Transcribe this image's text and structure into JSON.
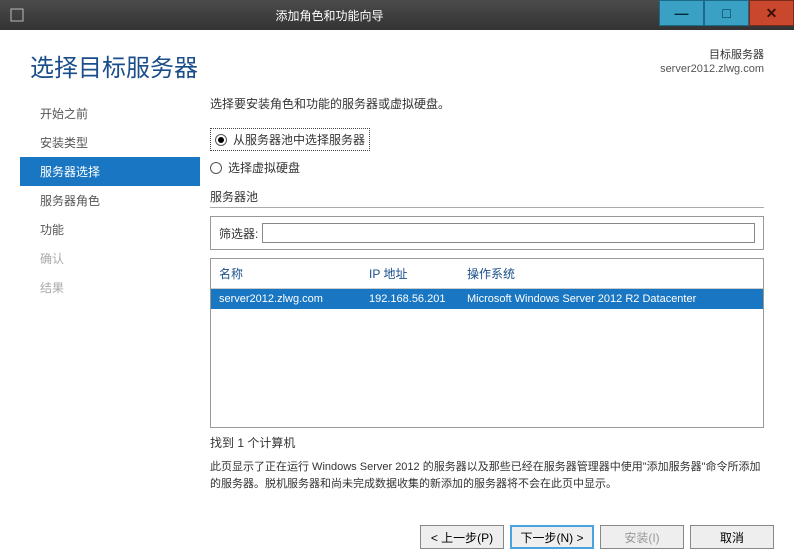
{
  "window": {
    "title": "添加角色和功能向导"
  },
  "header": {
    "page_title": "选择目标服务器",
    "target_label": "目标服务器",
    "target_server": "server2012.zlwg.com"
  },
  "nav": {
    "items": [
      {
        "label": "开始之前",
        "state": "normal"
      },
      {
        "label": "安装类型",
        "state": "normal"
      },
      {
        "label": "服务器选择",
        "state": "selected"
      },
      {
        "label": "服务器角色",
        "state": "normal"
      },
      {
        "label": "功能",
        "state": "normal"
      },
      {
        "label": "确认",
        "state": "disabled"
      },
      {
        "label": "结果",
        "state": "disabled"
      }
    ]
  },
  "main": {
    "instruction": "选择要安装角色和功能的服务器或虚拟硬盘。",
    "radio_pool": "从服务器池中选择服务器",
    "radio_vhd": "选择虚拟硬盘",
    "pool_label": "服务器池",
    "filter_label": "筛选器:",
    "filter_value": "",
    "columns": {
      "name": "名称",
      "ip": "IP 地址",
      "os": "操作系统"
    },
    "rows": [
      {
        "name": "server2012.zlwg.com",
        "ip": "192.168.56.201",
        "os": "Microsoft Windows Server 2012 R2 Datacenter"
      }
    ],
    "found_text": "找到 1 个计算机",
    "footer_note": "此页显示了正在运行 Windows Server 2012 的服务器以及那些已经在服务器管理器中使用\"添加服务器\"命令所添加的服务器。脱机服务器和尚未完成数据收集的新添加的服务器将不会在此页中显示。"
  },
  "buttons": {
    "prev": "< 上一步(P)",
    "next": "下一步(N) >",
    "install": "安装(I)",
    "cancel": "取消"
  }
}
